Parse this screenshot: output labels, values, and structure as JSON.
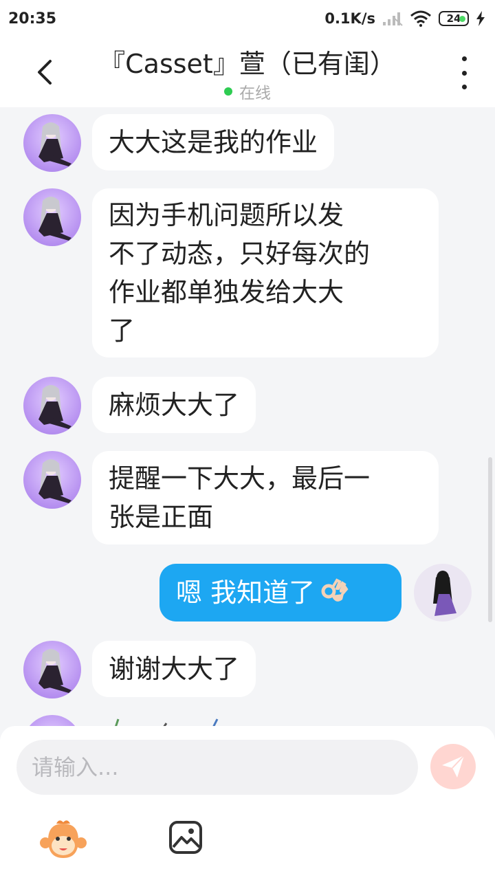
{
  "status_bar": {
    "time": "20:35",
    "net_speed": "0.1K/s",
    "battery": "24"
  },
  "header": {
    "title": "『Casset』萱（已有闺）",
    "presence": "在线"
  },
  "messages": [
    {
      "from": "other",
      "text": "大大这是我的作业"
    },
    {
      "from": "other",
      "lines": [
        "因为手机问题所以发",
        "不了动态，只好每次的",
        "作业都单独发给大大",
        "了"
      ]
    },
    {
      "from": "other",
      "text": "麻烦大大了"
    },
    {
      "from": "other",
      "lines": [
        "提醒一下大大，最后一",
        "张是正面"
      ]
    },
    {
      "from": "me",
      "text": "嗯 我知道了",
      "emoji": "ok-hand-icon"
    },
    {
      "from": "other",
      "text": "谢谢大大了"
    }
  ],
  "composer": {
    "placeholder": "请输入..."
  },
  "colors": {
    "my_bubble": "#1da7f2",
    "their_bubble": "#ffffff",
    "online": "#2ecc52",
    "send_button": "#ffd6d1"
  }
}
